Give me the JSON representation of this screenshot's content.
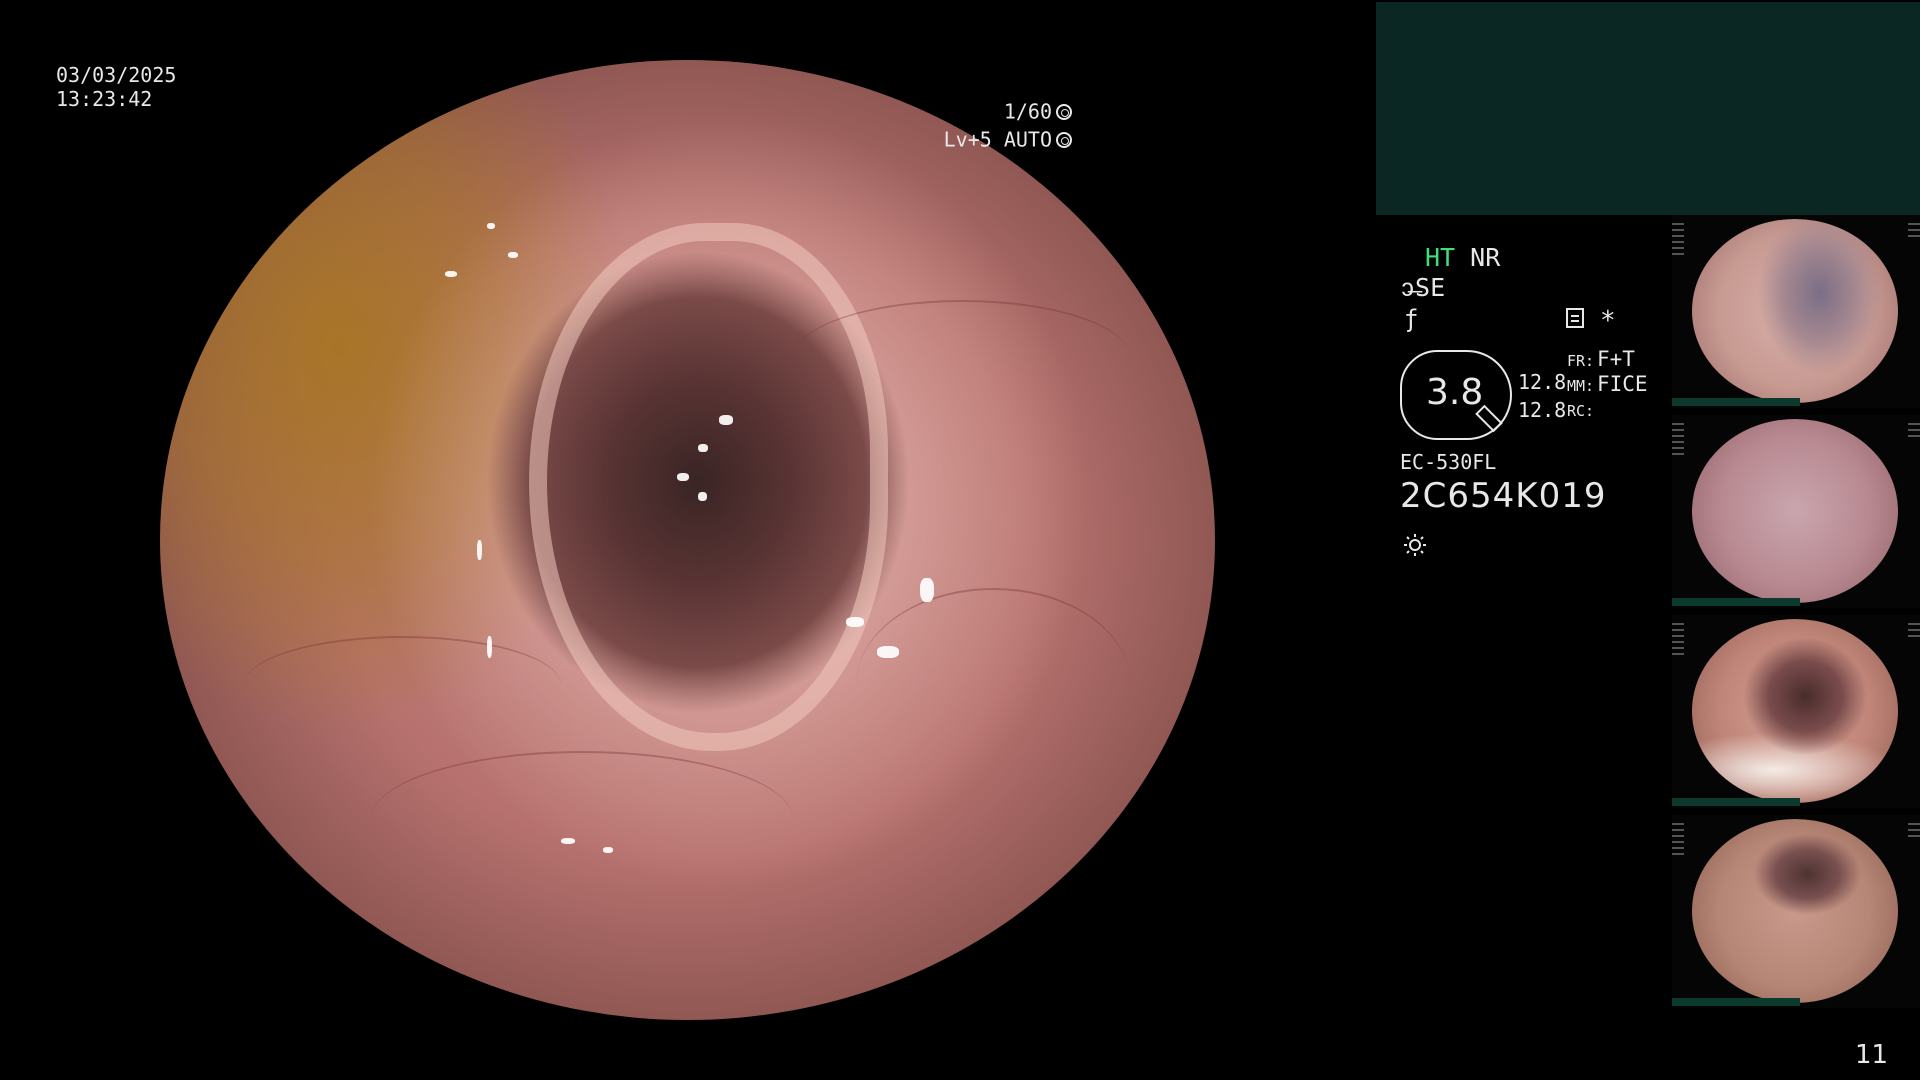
{
  "overlay": {
    "date": "03/03/2025",
    "time": "13:23:42",
    "shutter": "1/60",
    "level": "Lv+5 AUTO"
  },
  "status": {
    "ht": "HT",
    "nr": "NR",
    "se": "SE",
    "fstop_symbol": "ƒ",
    "star": "*"
  },
  "zoom": {
    "value": "3.8",
    "mm_value_1": "12.8",
    "mm_value_2": "12.8",
    "fr_label": "FR:",
    "fr_value": "F+T",
    "mm_label": "MM:",
    "mm_value": "FICE",
    "rc_label": "RC:"
  },
  "scope": {
    "model": "EC-530FL",
    "serial": "2C654K019"
  },
  "page_number": "11",
  "colors": {
    "ht_green": "#3fe07a",
    "panel_teal": "#0a2724",
    "thumb_bar": "#0c3a2e"
  },
  "icons": [
    "shutter-icon",
    "auto-exposure-icon",
    "scissor-icon",
    "rec-icon",
    "sun-icon"
  ]
}
